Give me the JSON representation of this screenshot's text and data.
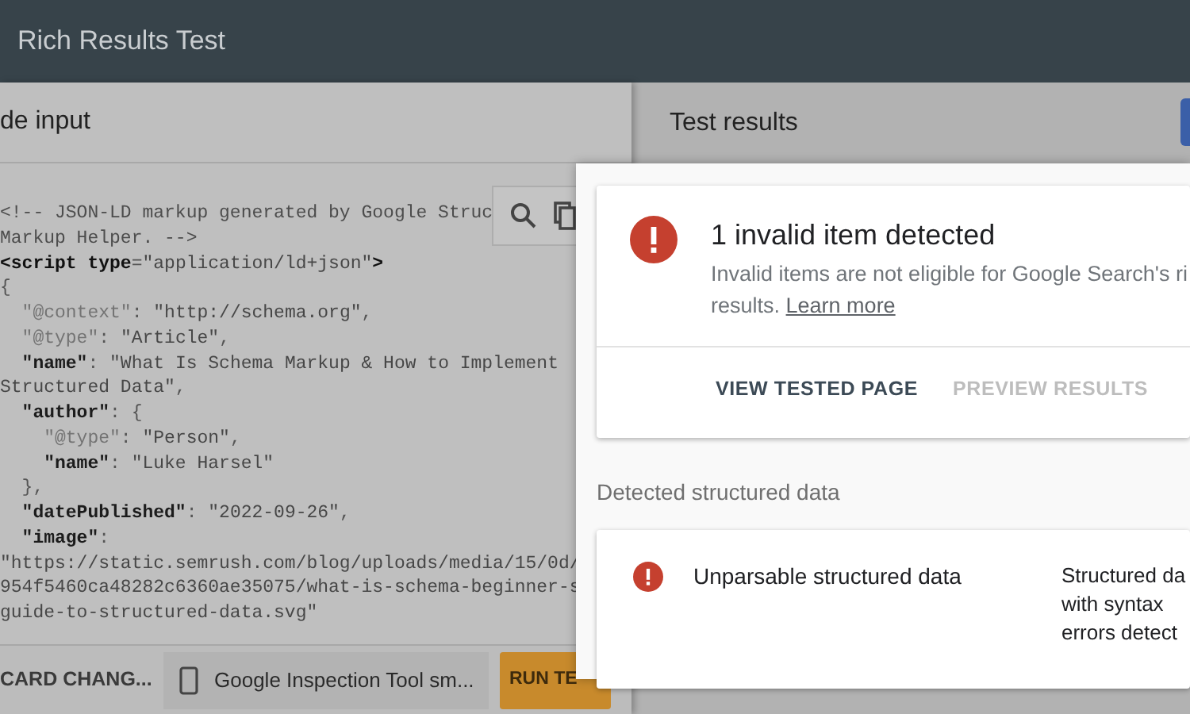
{
  "header": {
    "title": "Rich Results Test"
  },
  "code_panel": {
    "title": "de input",
    "lines": [
      [
        {
          "kind": "comment",
          "text": "<!-- JSON-LD markup generated by Google Struc"
        }
      ],
      [
        {
          "kind": "comment",
          "text": "Markup Helper. -->"
        }
      ],
      [
        {
          "kind": "tag",
          "text": "<script type"
        },
        {
          "kind": "punct",
          "text": "="
        },
        {
          "kind": "str",
          "text": "\"application/ld+json\""
        },
        {
          "kind": "tag",
          "text": ">"
        }
      ],
      [
        {
          "kind": "punct",
          "text": "{"
        }
      ],
      [
        {
          "kind": "meta_key",
          "text": "  \"@context\""
        },
        {
          "kind": "punct",
          "text": ": "
        },
        {
          "kind": "str",
          "text": "\"http://schema.org\""
        },
        {
          "kind": "punct",
          "text": ","
        }
      ],
      [
        {
          "kind": "meta_key",
          "text": "  \"@type\""
        },
        {
          "kind": "punct",
          "text": ": "
        },
        {
          "kind": "str",
          "text": "\"Article\""
        },
        {
          "kind": "punct",
          "text": ","
        }
      ],
      [
        {
          "kind": "key",
          "text": "  \"name\""
        },
        {
          "kind": "punct",
          "text": ": "
        },
        {
          "kind": "str",
          "text": "\"What Is Schema Markup & How to Implement"
        }
      ],
      [
        {
          "kind": "str",
          "text": "Structured Data\""
        },
        {
          "kind": "punct",
          "text": ","
        }
      ],
      [
        {
          "kind": "key",
          "text": "  \"author\""
        },
        {
          "kind": "punct",
          "text": ": {"
        }
      ],
      [
        {
          "kind": "meta_key",
          "text": "    \"@type\""
        },
        {
          "kind": "punct",
          "text": ": "
        },
        {
          "kind": "str",
          "text": "\"Person\""
        },
        {
          "kind": "punct",
          "text": ","
        }
      ],
      [
        {
          "kind": "key",
          "text": "    \"name\""
        },
        {
          "kind": "punct",
          "text": ": "
        },
        {
          "kind": "str",
          "text": "\"Luke Harsel\""
        }
      ],
      [
        {
          "kind": "punct",
          "text": "  },"
        }
      ],
      [
        {
          "kind": "key",
          "text": "  \"datePublished\""
        },
        {
          "kind": "punct",
          "text": ": "
        },
        {
          "kind": "str",
          "text": "\"2022-09-26\""
        },
        {
          "kind": "punct",
          "text": ","
        }
      ],
      [
        {
          "kind": "key",
          "text": "  \"image\""
        },
        {
          "kind": "punct",
          "text": ":"
        }
      ],
      [
        {
          "kind": "str",
          "text": "\"https://static.semrush.com/blog/uploads/media/15/0d/"
        }
      ],
      [
        {
          "kind": "str",
          "text": "954f5460ca48282c6360ae35075/what-is-schema-beginner-s"
        }
      ],
      [
        {
          "kind": "str",
          "text": "guide-to-structured-data.svg\""
        }
      ]
    ]
  },
  "bottom_bar": {
    "discard_button": "CARD CHANG...",
    "device_select": {
      "value": "Google Inspection Tool sm..."
    },
    "run_button": "RUN TE"
  },
  "results_panel": {
    "title": "Test results",
    "summary": {
      "title": "1 invalid item detected",
      "description_lines": [
        "Invalid items are not eligible for Google Search's ri",
        "results."
      ],
      "link": "Learn more"
    },
    "actions": [
      {
        "label": "VIEW TESTED PAGE",
        "disabled": false
      },
      {
        "label": "PREVIEW RESULTS",
        "disabled": true
      }
    ],
    "detected": {
      "heading": "Detected structured data",
      "items": [
        {
          "name": "Unparsable structured data",
          "detail_lines": [
            "Structured da",
            "with syntax",
            "errors detect"
          ]
        }
      ]
    }
  }
}
